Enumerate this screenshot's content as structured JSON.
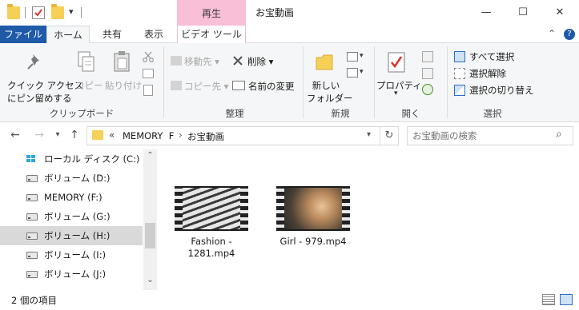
{
  "window": {
    "context_tab_header": "再生",
    "title": "お宝動画",
    "controls": {
      "minimize": "—",
      "maximize": "☐",
      "close": "✕"
    }
  },
  "quick_access": {
    "dropdown_glyph": "▾"
  },
  "tabs": [
    {
      "label": "ファイル"
    },
    {
      "label": "ホーム"
    },
    {
      "label": "共有"
    },
    {
      "label": "表示"
    },
    {
      "label": "ビデオ ツール"
    }
  ],
  "ribbon_collapse_glyph": "⌃",
  "help_glyph": "?",
  "ribbon": {
    "clipboard": {
      "pin_label_1": "クイック アクセス",
      "pin_label_2": "にピン留めする",
      "copy": "コピー",
      "paste": "貼り付け",
      "group": "クリップボード"
    },
    "organize": {
      "move_to": "移動先 ▾",
      "copy_to": "コピー先 ▾",
      "delete": "削除 ▾",
      "rename": "名前の変更",
      "group": "整理"
    },
    "new": {
      "new_folder_1": "新しい",
      "new_folder_2": "フォルダー",
      "group": "新規"
    },
    "open": {
      "properties": "プロパティ",
      "properties_arrow": "▾",
      "group": "開く"
    },
    "select": {
      "select_all": "すべて選択",
      "select_none": "選択解除",
      "invert": "選択の切り替え",
      "group": "選択"
    }
  },
  "address": {
    "back": "←",
    "forward": "→",
    "recent": "▾",
    "up": "↑",
    "chevron": "«",
    "crumbs": [
      "MEMORY  F",
      "お宝動画"
    ],
    "sep": "›",
    "dropdown": "▾",
    "refresh": "↻",
    "search_placeholder": "お宝動画の検索",
    "search_icon": "⌕"
  },
  "nav_pane": {
    "items": [
      {
        "label": "ローカル ディスク (C:)",
        "icon": "windows-drive-icon"
      },
      {
        "label": "ボリューム (D:)",
        "icon": "drive-icon"
      },
      {
        "label": "MEMORY (F:)",
        "icon": "drive-icon"
      },
      {
        "label": "ボリューム (G:)",
        "icon": "drive-icon"
      },
      {
        "label": "ボリューム (H:)",
        "icon": "drive-icon",
        "selected": true
      },
      {
        "label": "ボリューム (I:)",
        "icon": "drive-icon"
      },
      {
        "label": "ボリューム (J:)",
        "icon": "drive-icon"
      }
    ],
    "scroll_up": "⌃",
    "scroll_down": "⌄"
  },
  "files": [
    {
      "name_line1": "Fashion -",
      "name_line2": "1281.mp4"
    },
    {
      "name_line1": "Girl - 979.mp4",
      "name_line2": ""
    }
  ],
  "status": {
    "item_count": "2 個の項目"
  },
  "colors": {
    "file_tab": "#1e5aa8",
    "context_tab": "#f8bfd7",
    "folder": "#f6cf57",
    "selection": "#d9d9d9",
    "accent_blue": "#2a6fc9"
  }
}
